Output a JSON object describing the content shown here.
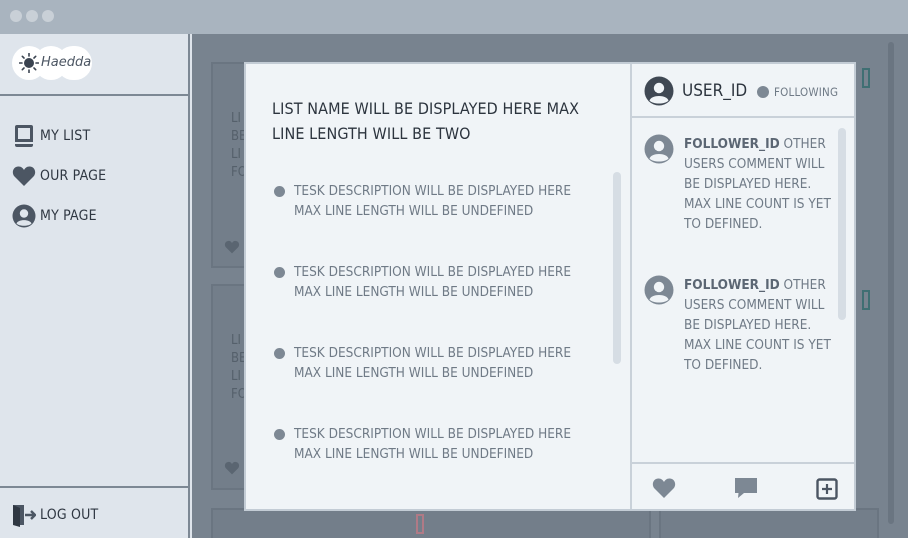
{
  "app": {
    "brand": "Haedda"
  },
  "sidebar": {
    "items": [
      {
        "label": "MY LIST",
        "icon": "book-icon"
      },
      {
        "label": "OUR PAGE",
        "icon": "heart-icon"
      },
      {
        "label": "MY PAGE",
        "icon": "user-icon"
      }
    ],
    "logout_label": "LOG OUT"
  },
  "background_cards": [
    {
      "lines": [
        "LI",
        "BE",
        "LI",
        "FO"
      ]
    },
    {
      "lines": [
        "LI",
        "BE",
        "LI",
        "FO"
      ]
    }
  ],
  "modal": {
    "list_title": "LIST NAME WILL BE DISPLAYED HERE MAX LINE LENGTH WILL BE TWO",
    "tasks": [
      "TESK DESCRIPTION WILL BE DISPLAYED HERE MAX LINE LENGTH WILL BE UNDEFINED",
      "TESK DESCRIPTION WILL BE DISPLAYED HERE MAX LINE LENGTH WILL BE UNDEFINED",
      "TESK DESCRIPTION WILL BE DISPLAYED HERE MAX LINE LENGTH WILL BE UNDEFINED",
      "TESK DESCRIPTION WILL BE DISPLAYED HERE MAX LINE LENGTH WILL BE UNDEFINED"
    ],
    "user": {
      "id": "USER_ID",
      "follow_status": "FOLLOWING"
    },
    "comments": [
      {
        "follower": "FOLLOWER_ID",
        "text": "OTHER USERS COMMENT WILL BE DISPLAYED HERE. MAX LINE COUNT IS YET TO DEFINED."
      },
      {
        "follower": "FOLLOWER_ID",
        "text": "OTHER USERS COMMENT WILL BE DISPLAYED HERE. MAX LINE COUNT IS YET TO DEFINED."
      }
    ],
    "actions": [
      {
        "icon": "heart-icon"
      },
      {
        "icon": "comment-icon"
      },
      {
        "icon": "add-icon"
      }
    ]
  },
  "colors": {
    "sidebar_bg": "#dfe5ec",
    "overlay": "#78838f",
    "modal_bg": "#f0f4f7",
    "icon_gray": "#7d8894",
    "accent_teal": "#3f6f73",
    "accent_pink": "#b07a86"
  }
}
